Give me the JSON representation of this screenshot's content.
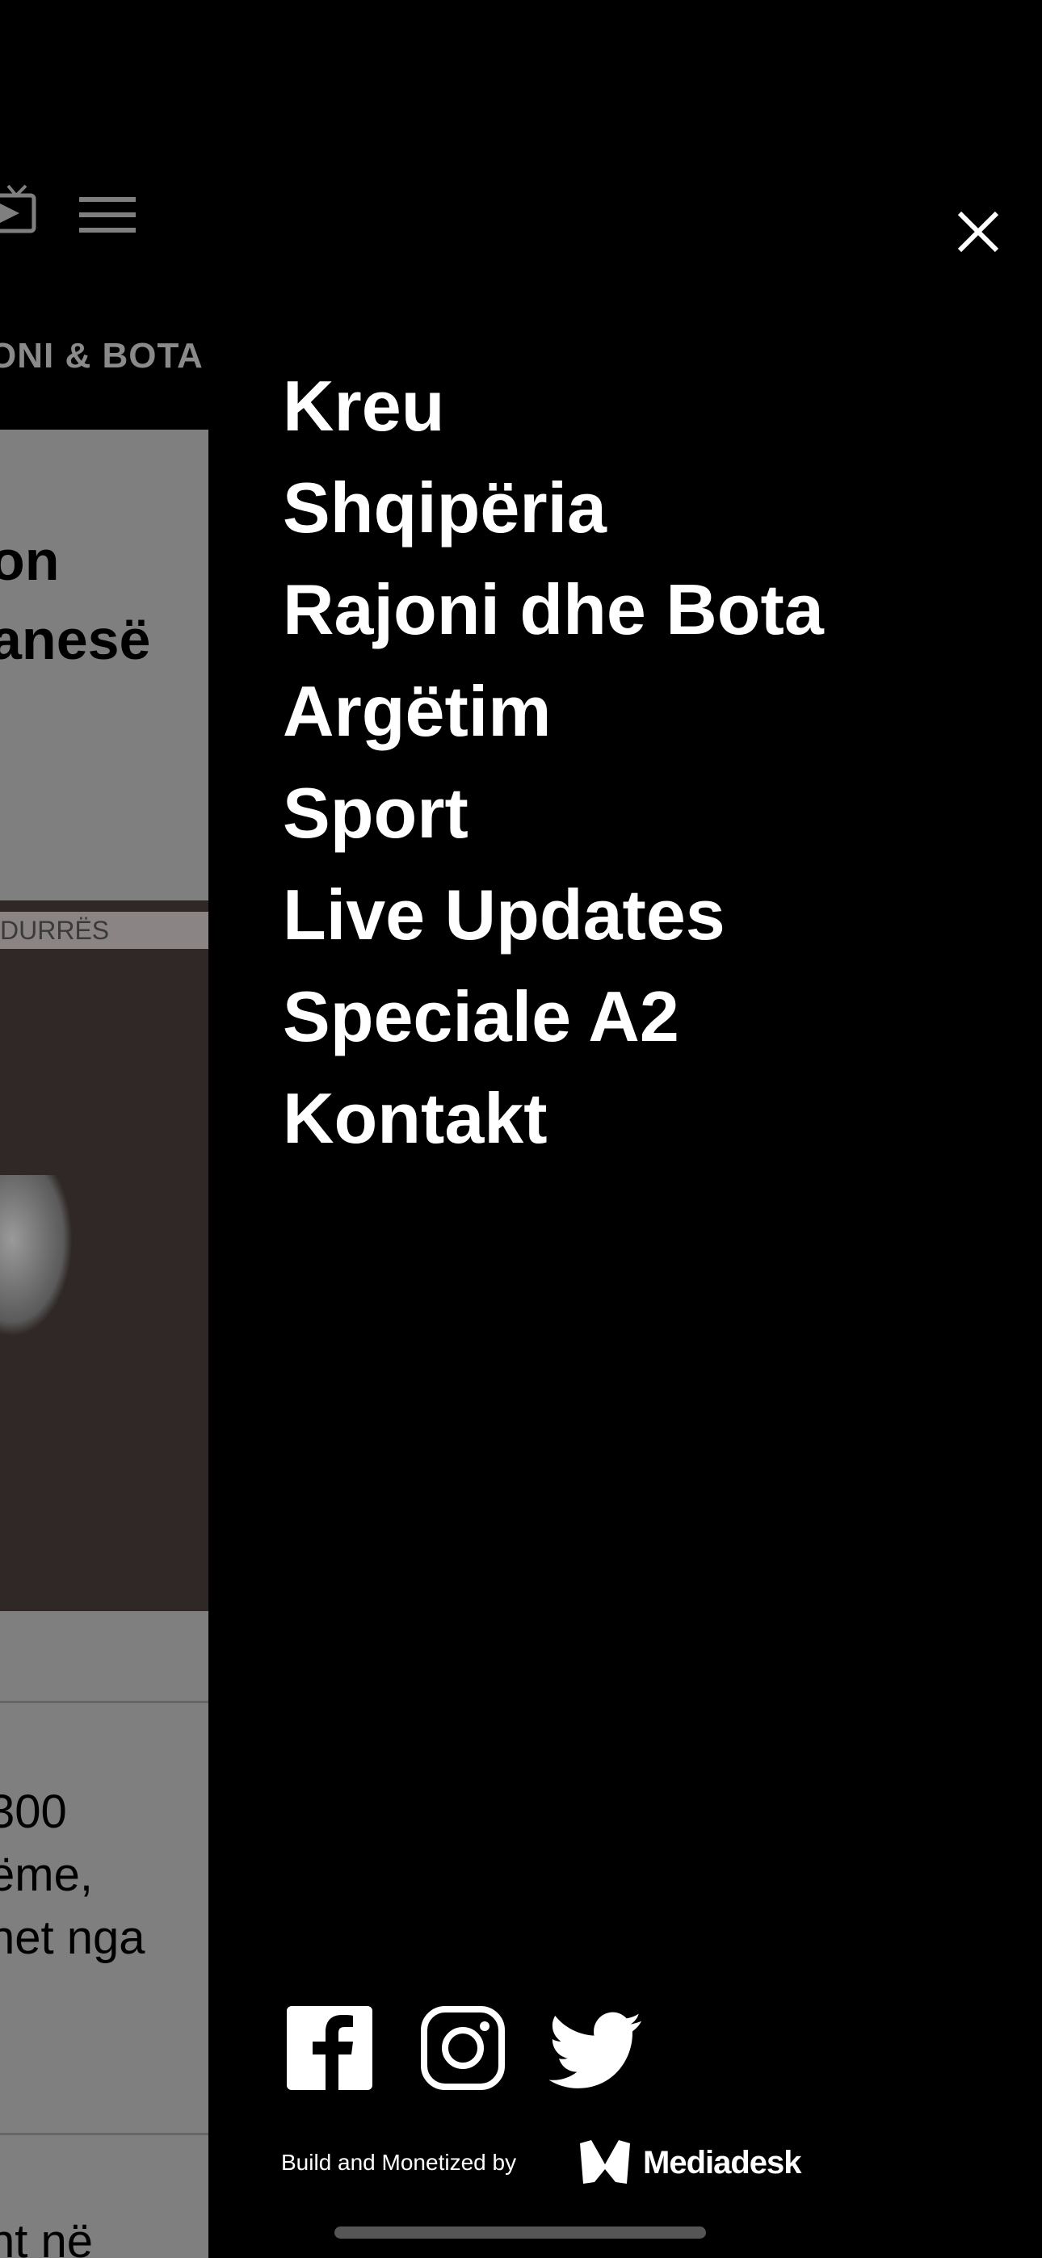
{
  "background_page": {
    "category": "ONI & BOTA",
    "headline_fragments": [
      "on",
      "anesë"
    ],
    "image_label": "DURRËS",
    "body_fragments": [
      "300",
      "ëme,",
      "net nga"
    ],
    "next_fragment": "nt në"
  },
  "menu": {
    "items": [
      {
        "label": "Kreu"
      },
      {
        "label": "Shqipëria"
      },
      {
        "label": "Rajoni dhe Bota"
      },
      {
        "label": "Argëtim"
      },
      {
        "label": "Sport"
      },
      {
        "label": "Live Updates"
      },
      {
        "label": "Speciale A2"
      },
      {
        "label": "Kontakt"
      }
    ]
  },
  "social": [
    "facebook-icon",
    "instagram-icon",
    "twitter-icon"
  ],
  "footer": {
    "text": "Build and Monetized by",
    "brand": "Mediadesk"
  },
  "colors": {
    "overlay": "#000000",
    "dimmed_page": "#7f7f7f",
    "menu_text": "#ffffff"
  }
}
